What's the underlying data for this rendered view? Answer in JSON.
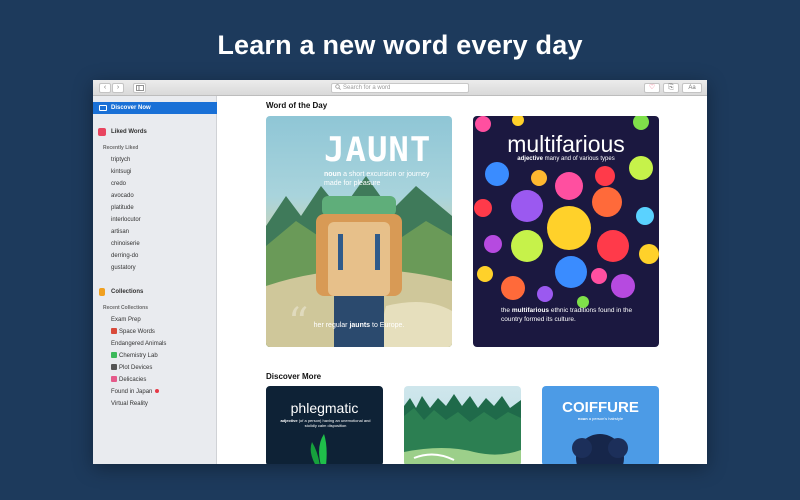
{
  "headline": "Learn a new word every day",
  "toolbar": {
    "back": "‹",
    "forward": "›",
    "search_placeholder": "Search for a word",
    "font_label": "Aa"
  },
  "sidebar": {
    "discover": "Discover Now",
    "liked": "Liked Words",
    "recently_liked_label": "Recently Liked",
    "recent_words": [
      "triptych",
      "kintsugi",
      "credo",
      "avocado",
      "platitude",
      "interlocutor",
      "artisan",
      "chinoiserie",
      "derring-do",
      "gustatory"
    ],
    "collections": "Collections",
    "recent_collections_label": "Recent Collections",
    "collections_list": [
      "Exam Prep",
      "Space Words",
      "Endangered Animals",
      "Chemistry Lab",
      "Plot Devices",
      "Delicacies",
      "Found in Japan",
      "Virtual Reality"
    ],
    "accent": "#1970d6"
  },
  "main": {
    "wotd_title": "Word of the Day",
    "discover_title": "Discover More",
    "jaunt": {
      "word": "JAUNT",
      "pos": "noun",
      "definition": "a short excursion or journey made for pleasure",
      "example_pre": "her regular ",
      "example_word": "jaunts",
      "example_post": " to Europe."
    },
    "multifarious": {
      "word": "multifarious",
      "pos": "adjective",
      "definition": "many and of various types",
      "example_pre": "the ",
      "example_word": "multifarious",
      "example_post": " ethnic traditions found in the country formed its culture."
    },
    "phlegmatic": {
      "word": "phlegmatic",
      "pos": "adjective",
      "definition": "(of a person) having an unemotional and stolidly calm disposition"
    },
    "coiffure": {
      "word": "COIFFURE",
      "pos": "noun",
      "definition": "a person's hairstyle"
    }
  }
}
